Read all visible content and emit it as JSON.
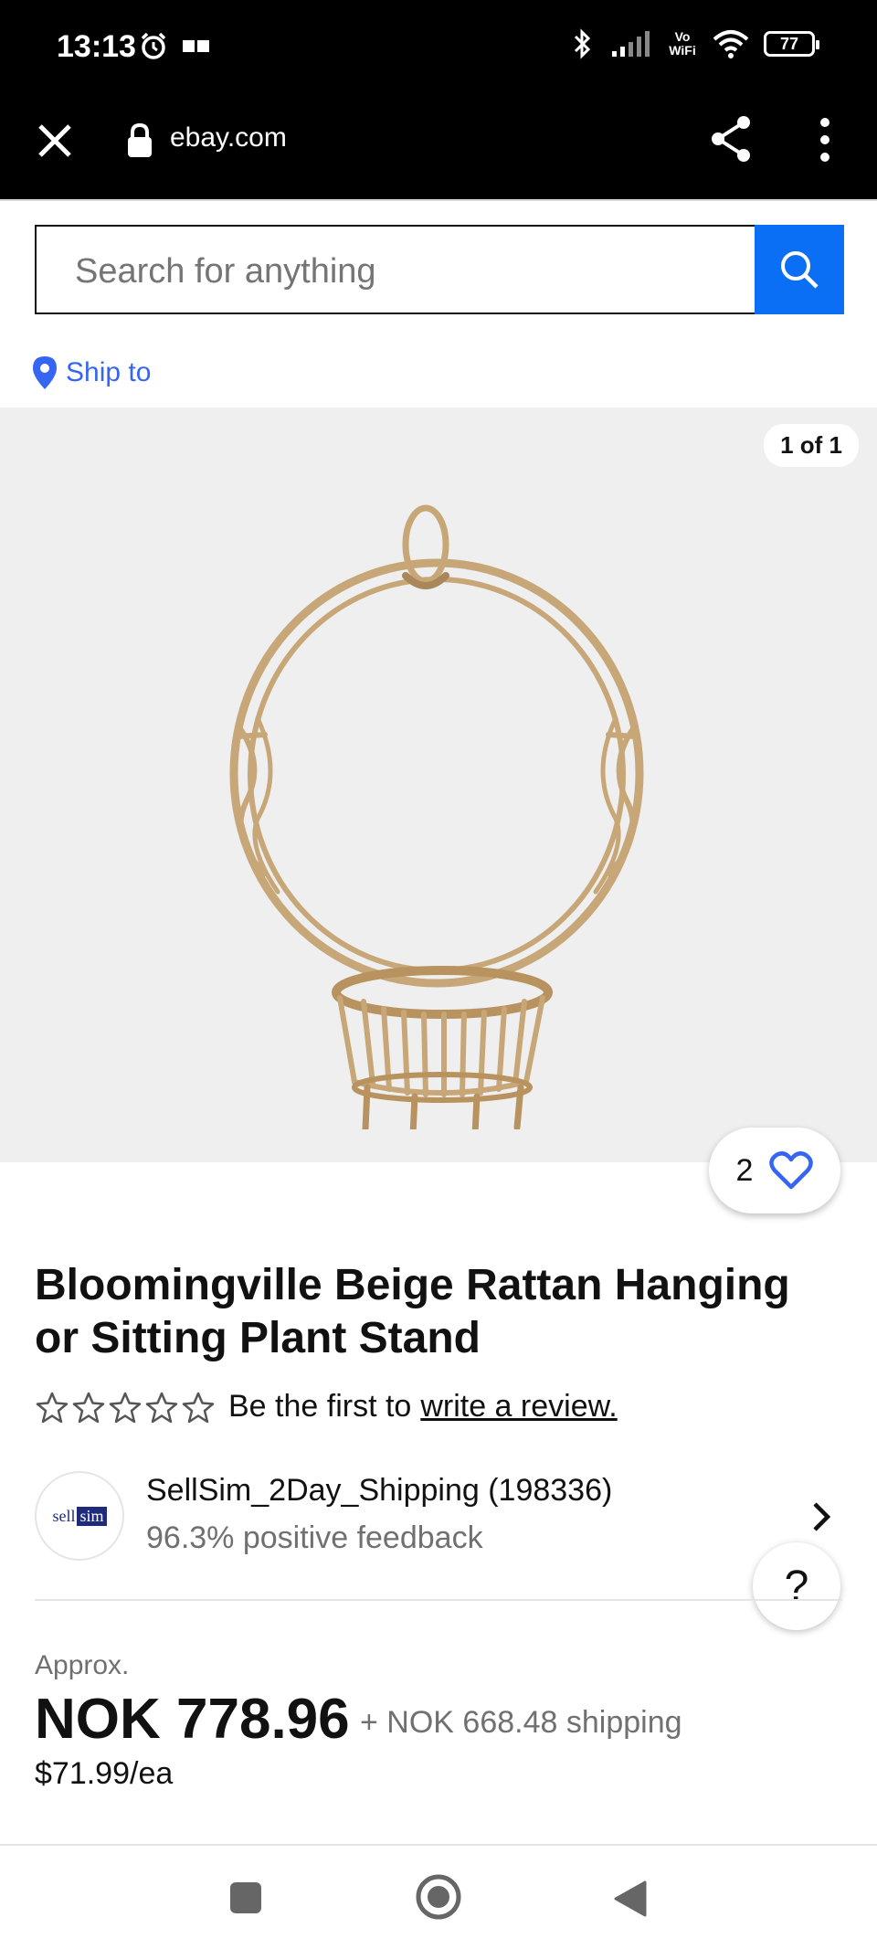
{
  "status_bar": {
    "time": "13:13",
    "battery": "77",
    "network_label": "Vo WiFi"
  },
  "browser": {
    "url": "ebay.com"
  },
  "search": {
    "placeholder": "Search for anything"
  },
  "ship_to": {
    "label": "Ship to"
  },
  "gallery": {
    "counter": "1 of 1"
  },
  "favorite": {
    "count": "2"
  },
  "product": {
    "title": "Bloomingville Beige Rattan Hanging or Sitting Plant Stand",
    "rating_prompt": "Be the first to",
    "review_link": "write a review."
  },
  "seller": {
    "name": "SellSim_2Day_Shipping (198336)",
    "feedback": "96.3% positive feedback",
    "logo_text_a": "sell",
    "logo_text_b": "sim"
  },
  "help": {
    "label": "?"
  },
  "pricing": {
    "approx_label": "Approx.",
    "price": "NOK 778.96",
    "shipping": "+ NOK 668.48 shipping",
    "per_each": "$71.99/ea"
  },
  "colors": {
    "accent": "#3665f3",
    "search_button": "#0a6ff5"
  }
}
